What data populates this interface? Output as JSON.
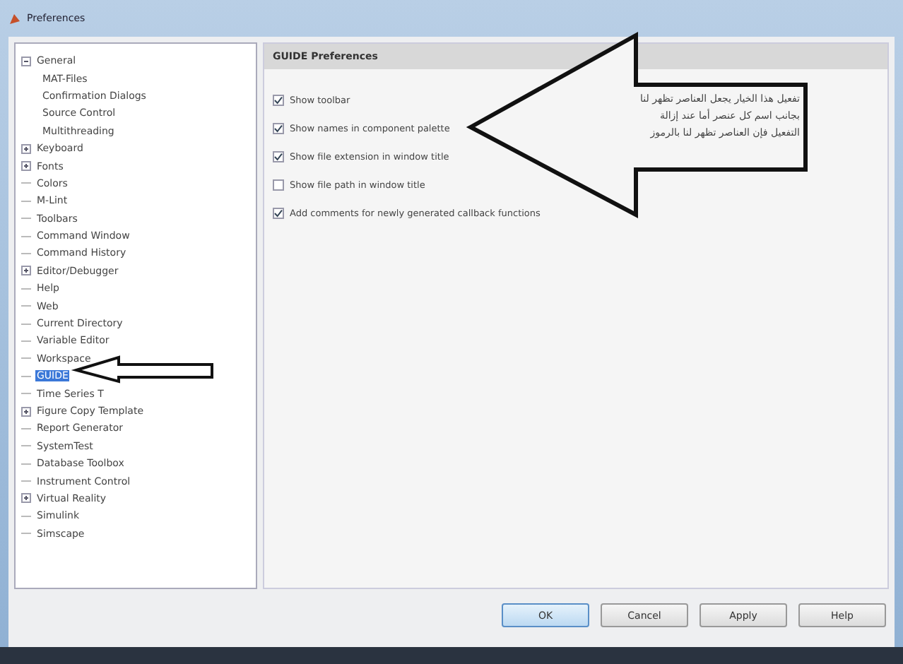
{
  "window": {
    "title": "Preferences"
  },
  "sidebar": {
    "items": [
      {
        "label": "General",
        "expandable": true,
        "expanded": true,
        "selected": false,
        "children": [
          {
            "label": "MAT-Files",
            "selected": false
          },
          {
            "label": "Confirmation Dialogs",
            "selected": false
          },
          {
            "label": "Source Control",
            "selected": false
          },
          {
            "label": "Multithreading",
            "selected": false
          }
        ]
      },
      {
        "label": "Keyboard",
        "expandable": true,
        "expanded": false,
        "selected": false
      },
      {
        "label": "Fonts",
        "expandable": true,
        "expanded": false,
        "selected": false
      },
      {
        "label": "Colors",
        "expandable": false,
        "selected": false
      },
      {
        "label": "M-Lint",
        "expandable": false,
        "selected": false
      },
      {
        "label": "Toolbars",
        "expandable": false,
        "selected": false
      },
      {
        "label": "Command Window",
        "expandable": false,
        "selected": false
      },
      {
        "label": "Command History",
        "expandable": false,
        "selected": false
      },
      {
        "label": "Editor/Debugger",
        "expandable": true,
        "expanded": false,
        "selected": false
      },
      {
        "label": "Help",
        "expandable": false,
        "selected": false
      },
      {
        "label": "Web",
        "expandable": false,
        "selected": false
      },
      {
        "label": "Current Directory",
        "expandable": false,
        "selected": false
      },
      {
        "label": "Variable Editor",
        "expandable": false,
        "selected": false
      },
      {
        "label": "Workspace",
        "expandable": false,
        "selected": false
      },
      {
        "label": "GUIDE",
        "expandable": false,
        "selected": true
      },
      {
        "label": "Time Series T",
        "expandable": false,
        "selected": false
      },
      {
        "label": "Figure Copy Template",
        "expandable": true,
        "expanded": false,
        "selected": false
      },
      {
        "label": "Report Generator",
        "expandable": false,
        "selected": false
      },
      {
        "label": "SystemTest",
        "expandable": false,
        "selected": false
      },
      {
        "label": "Database Toolbox",
        "expandable": false,
        "selected": false
      },
      {
        "label": "Instrument Control",
        "expandable": false,
        "selected": false
      },
      {
        "label": "Virtual Reality",
        "expandable": true,
        "expanded": false,
        "selected": false
      },
      {
        "label": "Simulink",
        "expandable": false,
        "selected": false
      },
      {
        "label": "Simscape",
        "expandable": false,
        "selected": false
      }
    ]
  },
  "panel": {
    "title": "GUIDE Preferences",
    "options": [
      {
        "label": "Show toolbar",
        "checked": true
      },
      {
        "label": "Show names in component palette",
        "checked": true
      },
      {
        "label": "Show file extension in window title",
        "checked": true
      },
      {
        "label": "Show file path in window title",
        "checked": false
      },
      {
        "label": "Add comments for newly generated callback functions",
        "checked": true
      }
    ]
  },
  "callout": {
    "lines": [
      "تفعيل هذا الخيار يجعل العناصر تظهر لنا",
      "بجانب اسم كل عنصر أما عند إزالة",
      "التفعيل فإن العناصر تظهر لنا بالرموز"
    ]
  },
  "buttons": [
    {
      "label": "OK",
      "default": true
    },
    {
      "label": "Cancel",
      "default": false
    },
    {
      "label": "Apply",
      "default": false
    },
    {
      "label": "Help",
      "default": false
    }
  ]
}
